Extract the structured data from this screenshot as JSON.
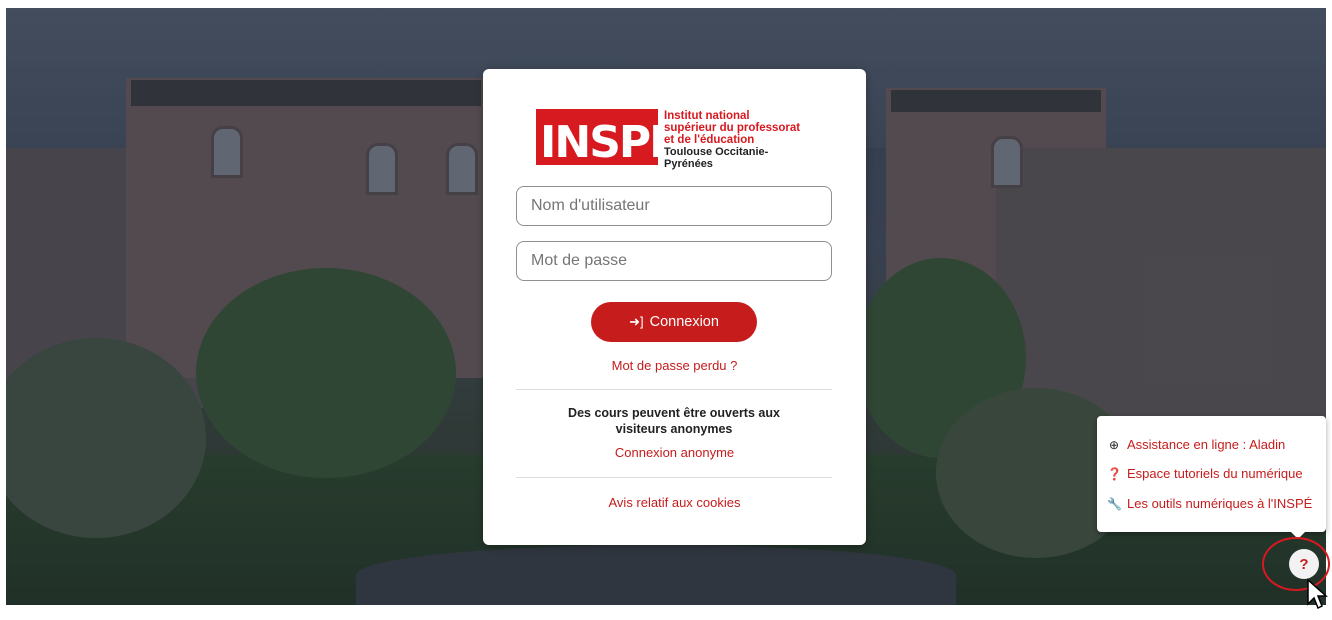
{
  "logo": {
    "mark": "INSPÉ",
    "line1": "Institut national",
    "line2": "supérieur du professorat",
    "line3": "et de l'éducation",
    "line4": "Toulouse Occitanie-Pyrénées"
  },
  "login": {
    "username_placeholder": "Nom d'utilisateur",
    "password_placeholder": "Mot de passe",
    "submit_label": "Connexion",
    "lost_password": "Mot de passe perdu ?",
    "guest_text": "Des cours peuvent être ouverts aux visiteurs anonymes",
    "guest_link": "Connexion anonyme",
    "cookies_link": "Avis relatif aux cookies"
  },
  "help_menu": {
    "items": [
      {
        "icon": "lifebuoy-icon",
        "label": "Assistance en ligne : Aladin"
      },
      {
        "icon": "question-circle-icon",
        "label": "Espace tutoriels du numérique"
      },
      {
        "icon": "wrench-icon",
        "label": "Les outils numériques à l'INSPÉ"
      }
    ],
    "button_label": "?"
  },
  "colors": {
    "accent": "#c61c1c",
    "brand_red": "#d71920",
    "highlight_ring": "#d71920"
  }
}
